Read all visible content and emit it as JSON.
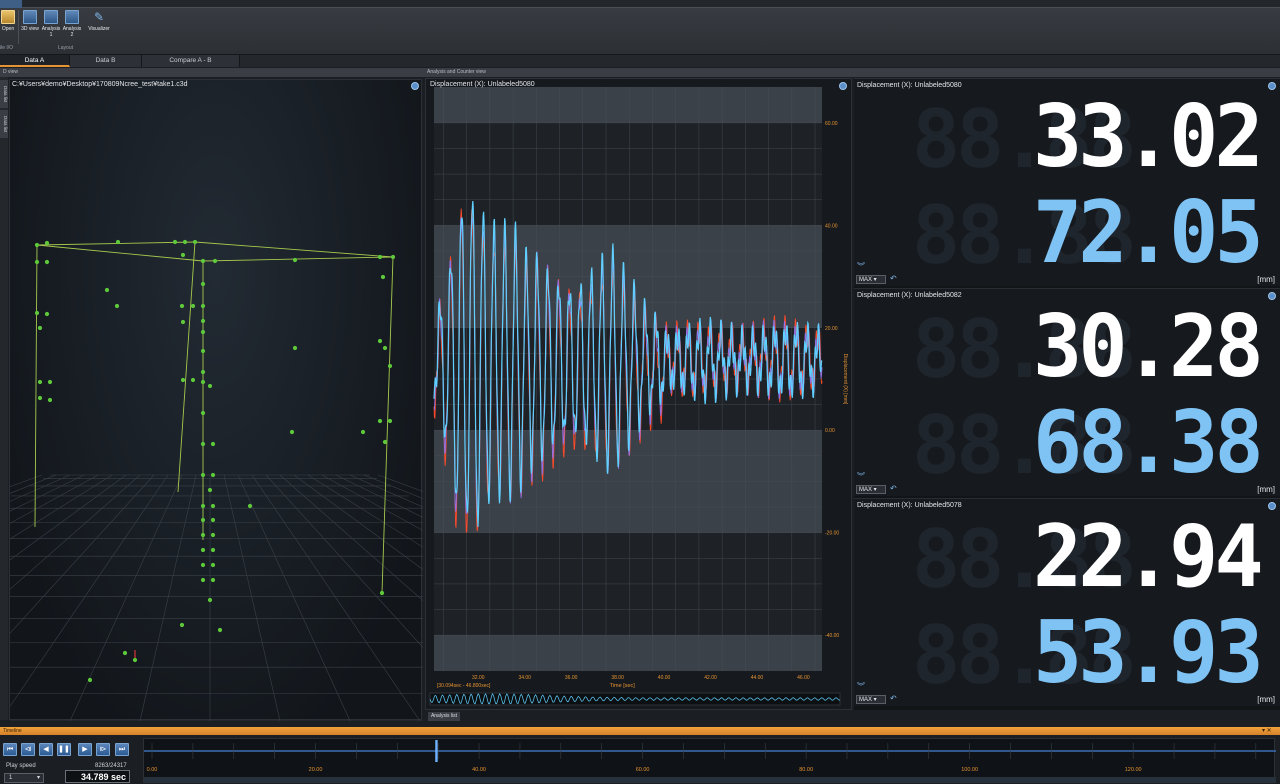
{
  "ribbon": {
    "buttons": [
      {
        "label": "Open",
        "icon": "folder-open-icon"
      },
      {
        "label": "3D view",
        "icon": "3d-view-icon"
      },
      {
        "label": "Analysis 1",
        "icon": "analysis-layout-1-icon"
      },
      {
        "label": "Analysis 2",
        "icon": "analysis-layout-2-icon"
      },
      {
        "label": "Visualizer",
        "icon": "visualizer-icon"
      }
    ],
    "groups": {
      "file_io": "ile I/O",
      "layout": "Layout"
    }
  },
  "data_tabs": [
    {
      "label": "Data A",
      "active": true
    },
    {
      "label": "Data B",
      "active": false
    },
    {
      "label": "Compare A - B",
      "active": false
    }
  ],
  "panels": {
    "view3d_header": "D view",
    "analysis_header": "Analysis and Counter view",
    "side_tabs": [
      "Data list",
      "Data list"
    ],
    "file_path": "C:¥Users¥demo¥Desktop¥170809Ncree_test¥take1.c3d"
  },
  "chart_data": {
    "type": "line",
    "title": "Displacement (X):  Unlabeled5080",
    "xlabel": "Time [sec]",
    "ylabel": "Displacement (X) [mm]",
    "x_ticks": [
      "32.00",
      "34.00",
      "36.00",
      "38.00",
      "40.00",
      "42.00",
      "44.00",
      "46.00"
    ],
    "y_ticks": [
      "60.00",
      "40.00",
      "20.00",
      "0.00",
      "-20.00",
      "-40.00"
    ],
    "xlim": [
      30.094,
      46.8
    ],
    "ylim": [
      -47,
      67
    ],
    "range_label": "[30.094sec - 46.800sec]",
    "series_colors": [
      "#ff4a2a",
      "#8f72e8",
      "#5fd0ff"
    ],
    "colors": {
      "axis_text": "#e59433",
      "line_a": "#ff4a2a",
      "line_b": "#8f72e8",
      "line_c": "#5fd0ff"
    }
  },
  "meters": [
    {
      "title": "Displacement (X):  Unlabeled5080",
      "value_top": "33.02",
      "value_bottom": "72.05",
      "unit": "[mm]",
      "mode": "MAX"
    },
    {
      "title": "Displacement (X):  Unlabeled5082",
      "value_top": "30.28",
      "value_bottom": "68.38",
      "unit": "[mm]",
      "mode": "MAX"
    },
    {
      "title": "Displacement (X):  Unlabeled5078",
      "value_top": "22.94",
      "value_bottom": "53.93",
      "unit": "[mm]",
      "mode": "MAX"
    }
  ],
  "timeline": {
    "header": "Timeline",
    "play_speed_label": "Play speed",
    "play_speed_value": "1",
    "frame_counter": "8263/24317",
    "current_time": "34.789 sec",
    "ticks": [
      "0.00",
      "20.00",
      "40.00",
      "60.00",
      "80.00",
      "100.00",
      "120.00"
    ],
    "xlim": [
      0,
      136
    ],
    "cursor": 34.789,
    "controls": [
      "skip-start-icon",
      "step-back-icon",
      "play-reverse-icon",
      "pause-icon",
      "play-icon",
      "step-forward-icon",
      "skip-end-icon"
    ]
  },
  "analysis_list_tab": "Analysis list"
}
